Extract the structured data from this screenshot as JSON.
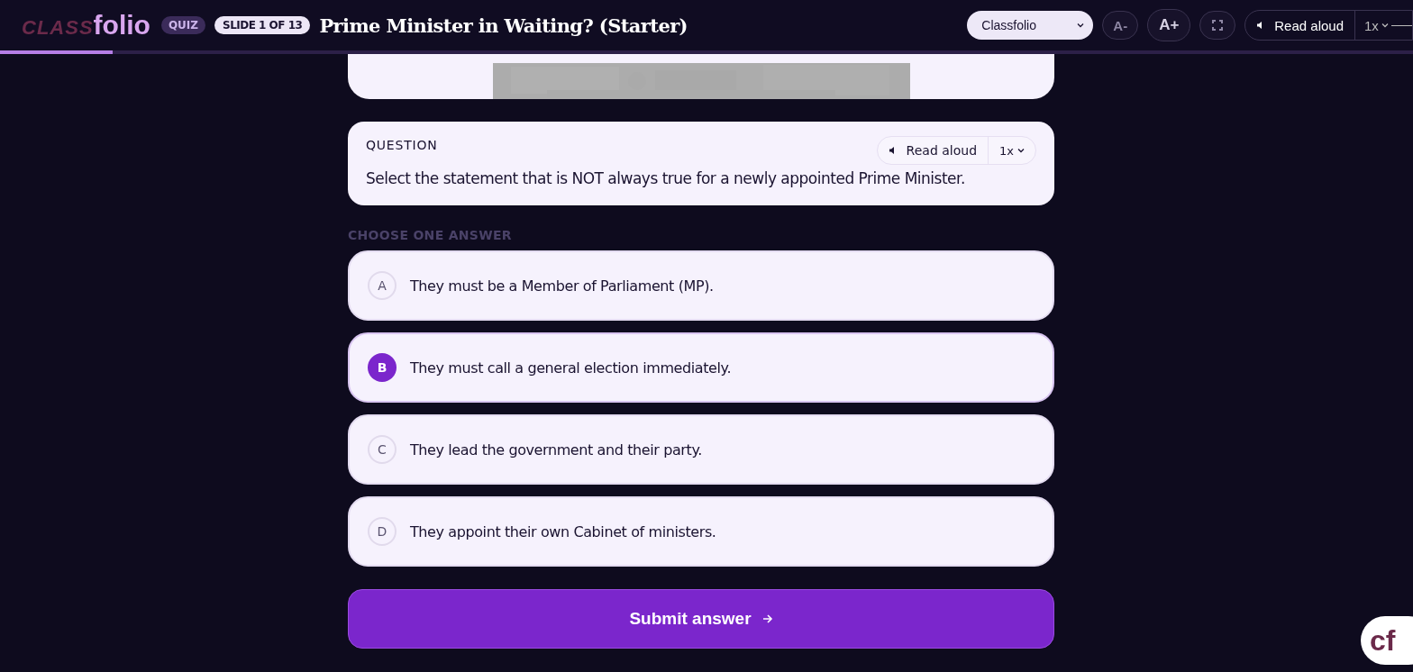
{
  "header": {
    "logo": {
      "left": "CLASS",
      "right": "folio"
    },
    "badge": "QUIZ",
    "slide_counter": "SLIDE 1 OF 13",
    "title": "Prime Minister in Waiting? (Starter)",
    "theme_select": {
      "value": "Classfolio"
    },
    "font_smaller": "A-",
    "font_larger": "A+",
    "read_aloud": "Read aloud",
    "speed": "1x"
  },
  "progress": {
    "level": 0.08
  },
  "question": {
    "label": "QUESTION",
    "read_aloud": "Read aloud",
    "speed": "1x",
    "text": "Select the statement that is NOT always true for a newly appointed Prime Minister."
  },
  "answers_label": "CHOOSE ONE ANSWER",
  "answers": [
    {
      "letter": "A",
      "text": "They must be a Member of Parliament (MP).",
      "selected": false
    },
    {
      "letter": "B",
      "text": "They must call a general election immediately.",
      "selected": true
    },
    {
      "letter": "C",
      "text": "They lead the government and their party.",
      "selected": false
    },
    {
      "letter": "D",
      "text": "They appoint their own Cabinet of ministers.",
      "selected": false
    }
  ],
  "submit": "Submit answer",
  "corner_badge": "cf"
}
